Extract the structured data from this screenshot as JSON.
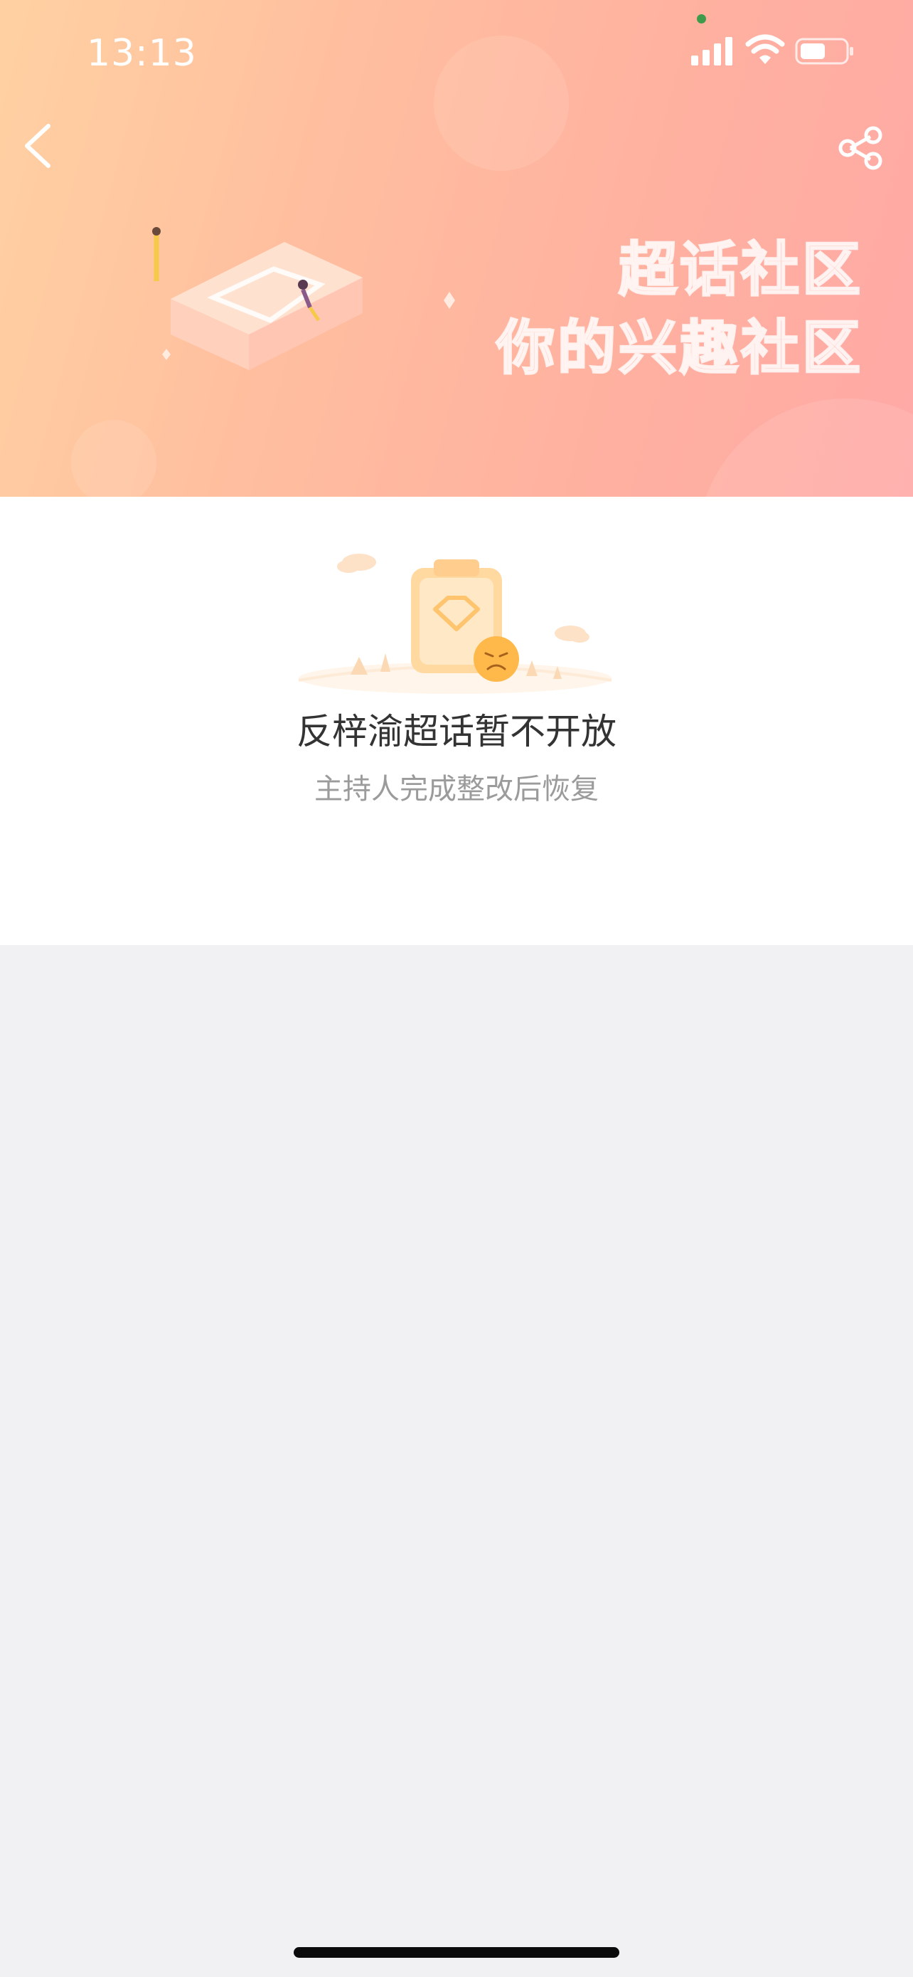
{
  "status_bar": {
    "time": "13:13"
  },
  "navigation": {
    "back_icon": "chevron-left-icon",
    "share_icon": "share-icon"
  },
  "banner": {
    "slogan_line1": "超话社区",
    "slogan_line2": "你的兴趣社区",
    "colors": {
      "gradient_start": "#ffd1a2",
      "gradient_end": "#ffa9a6"
    }
  },
  "empty_state": {
    "illustration": "sad-clipboard-illustration",
    "title": "反梓渝超话暂不开放",
    "subtitle": "主持人完成整改后恢复"
  },
  "colors": {
    "page_background": "#f1f1f3",
    "card_background": "#ffffff",
    "title_text": "#333333",
    "subtitle_text": "#9b9b9b"
  }
}
